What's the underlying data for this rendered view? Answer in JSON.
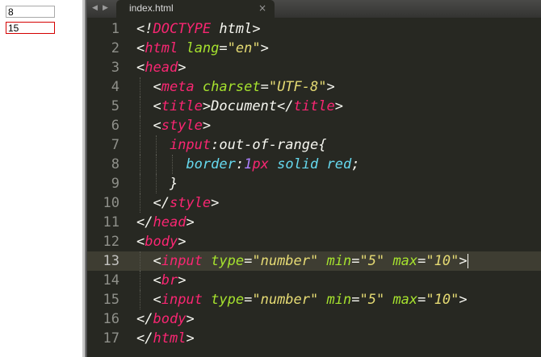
{
  "preview": {
    "input1_value": "8",
    "input2_value": "15"
  },
  "editor": {
    "tab_title": "index.html",
    "tab_close": "×",
    "nav_prev": "◀",
    "nav_next": "▶",
    "lines": [
      {
        "num": "1",
        "tokens": [
          [
            "p",
            "<!"
          ],
          [
            "t",
            "DOCTYPE"
          ],
          [
            "p",
            " "
          ],
          [
            "p",
            "html"
          ],
          [
            "p",
            ">"
          ]
        ]
      },
      {
        "num": "2",
        "tokens": [
          [
            "p",
            "<"
          ],
          [
            "t",
            "html"
          ],
          [
            "p",
            " "
          ],
          [
            "a",
            "lang"
          ],
          [
            "p",
            "="
          ],
          [
            "s",
            "\"en\""
          ],
          [
            "p",
            ">"
          ]
        ]
      },
      {
        "num": "3",
        "tokens": [
          [
            "p",
            "<"
          ],
          [
            "t",
            "head"
          ],
          [
            "p",
            ">"
          ]
        ]
      },
      {
        "num": "4",
        "tokens": [
          [
            "p",
            "  <"
          ],
          [
            "t",
            "meta"
          ],
          [
            "p",
            " "
          ],
          [
            "a",
            "charset"
          ],
          [
            "p",
            "="
          ],
          [
            "s",
            "\"UTF-8\""
          ],
          [
            "p",
            ">"
          ]
        ]
      },
      {
        "num": "5",
        "tokens": [
          [
            "p",
            "  <"
          ],
          [
            "t",
            "title"
          ],
          [
            "p",
            ">Document</"
          ],
          [
            "t",
            "title"
          ],
          [
            "p",
            ">"
          ]
        ]
      },
      {
        "num": "6",
        "tokens": [
          [
            "p",
            "  <"
          ],
          [
            "t",
            "style"
          ],
          [
            "p",
            ">"
          ]
        ]
      },
      {
        "num": "7",
        "tokens": [
          [
            "p",
            "    "
          ],
          [
            "t",
            "input"
          ],
          [
            "p",
            ":out-of-range{"
          ]
        ]
      },
      {
        "num": "8",
        "tokens": [
          [
            "p",
            "      "
          ],
          [
            "k",
            "border"
          ],
          [
            "p",
            ":"
          ],
          [
            "n",
            "1"
          ],
          [
            "t",
            "px"
          ],
          [
            "p",
            " "
          ],
          [
            "k",
            "solid"
          ],
          [
            "p",
            " "
          ],
          [
            "k",
            "red"
          ],
          [
            "p",
            ";"
          ]
        ]
      },
      {
        "num": "9",
        "tokens": [
          [
            "p",
            "    }"
          ]
        ]
      },
      {
        "num": "10",
        "tokens": [
          [
            "p",
            "  </"
          ],
          [
            "t",
            "style"
          ],
          [
            "p",
            ">"
          ]
        ]
      },
      {
        "num": "11",
        "tokens": [
          [
            "p",
            "</"
          ],
          [
            "t",
            "head"
          ],
          [
            "p",
            ">"
          ]
        ]
      },
      {
        "num": "12",
        "tokens": [
          [
            "p",
            "<"
          ],
          [
            "t",
            "body"
          ],
          [
            "p",
            ">"
          ]
        ]
      },
      {
        "num": "13",
        "active": true,
        "tokens": [
          [
            "p",
            "  <"
          ],
          [
            "t",
            "input"
          ],
          [
            "p",
            " "
          ],
          [
            "a",
            "type"
          ],
          [
            "p",
            "="
          ],
          [
            "s",
            "\"number\""
          ],
          [
            "p",
            " "
          ],
          [
            "a",
            "min"
          ],
          [
            "p",
            "="
          ],
          [
            "s",
            "\"5\""
          ],
          [
            "p",
            " "
          ],
          [
            "a",
            "max"
          ],
          [
            "p",
            "="
          ],
          [
            "s",
            "\"10\""
          ],
          [
            "p",
            ">"
          ]
        ]
      },
      {
        "num": "14",
        "tokens": [
          [
            "p",
            "  <"
          ],
          [
            "t",
            "br"
          ],
          [
            "p",
            ">"
          ]
        ]
      },
      {
        "num": "15",
        "tokens": [
          [
            "p",
            "  <"
          ],
          [
            "t",
            "input"
          ],
          [
            "p",
            " "
          ],
          [
            "a",
            "type"
          ],
          [
            "p",
            "="
          ],
          [
            "s",
            "\"number\""
          ],
          [
            "p",
            " "
          ],
          [
            "a",
            "min"
          ],
          [
            "p",
            "="
          ],
          [
            "s",
            "\"5\""
          ],
          [
            "p",
            " "
          ],
          [
            "a",
            "max"
          ],
          [
            "p",
            "="
          ],
          [
            "s",
            "\"10\""
          ],
          [
            "p",
            ">"
          ]
        ]
      },
      {
        "num": "16",
        "tokens": [
          [
            "p",
            "</"
          ],
          [
            "t",
            "body"
          ],
          [
            "p",
            ">"
          ]
        ]
      },
      {
        "num": "17",
        "tokens": [
          [
            "p",
            "</"
          ],
          [
            "t",
            "html"
          ],
          [
            "p",
            ">"
          ]
        ]
      }
    ]
  }
}
